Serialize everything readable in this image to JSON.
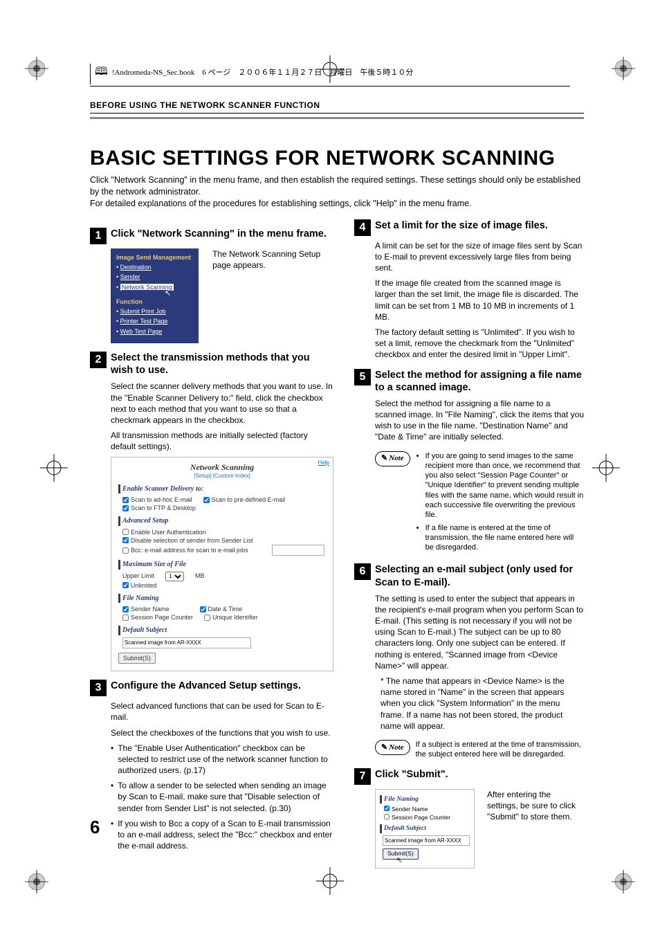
{
  "running_head": "!Andromeda-NS_Sec.book　6 ページ　２００６年１１月２７日　月曜日　午後５時１０分",
  "section_header": "BEFORE USING THE NETWORK SCANNER FUNCTION",
  "main_title": "BASIC SETTINGS FOR NETWORK SCANNING",
  "intro_p1": "Click \"Network Scanning\" in the menu frame, and then establish the required settings. These settings should only be established by the network administrator.",
  "intro_p2": "For detailed explanations of the procedures for establishing settings, click \"Help\" in the menu frame.",
  "step1": {
    "num": "1",
    "title": "Click \"Network Scanning\" in the menu frame.",
    "desc": "The Network Scanning Setup page appears.",
    "menu": {
      "hdr1": "Image Send Management",
      "i1": "Destination",
      "i2": "Sender",
      "i3": "Network Scanning",
      "hdr2": "Function",
      "i4": "Submit Print Job",
      "i5": "Printer Test Page",
      "i6": "Web Test Page"
    }
  },
  "step2": {
    "num": "2",
    "title": "Select the transmission methods that you wish to use.",
    "p1": "Select the scanner delivery methods that you want to use. In the \"Enable Scanner Delivery to:\" field, click the checkbox next to each method that you want to use so that a checkmark appears in the checkbox.",
    "p2": "All transmission methods are initially selected (factory default settings).",
    "form": {
      "help": "Help",
      "title": "Network Scanning",
      "sublinks": "[Setup] [Custom Index]",
      "sec_enable": "Enable Scanner Delivery to:",
      "cb_adhoc": "Scan to ad-hoc E-mail",
      "cb_predef": "Scan to pre-defined E-mail",
      "cb_ftp": "Scan to FTP & Desktop",
      "sec_adv": "Advanced Setup",
      "cb_auth": "Enable User Authentication",
      "cb_disable": "Disable selection of sender from Sender List",
      "lbl_bcc": "Bcc: e-mail address for scan to e-mail jobs",
      "sec_max": "Maximum Size of File",
      "lbl_upper": "Upper Limit",
      "sel_val": "1",
      "lbl_mb": "MB",
      "cb_unl": "Unlimited",
      "sec_file": "File Naming",
      "cb_sender": "Sender Name",
      "cb_date": "Date & Time",
      "cb_session": "Session Page Counter",
      "cb_unique": "Unique Identifier",
      "sec_def": "Default Subject",
      "txt_def": "Scanned image from AR-XXXX",
      "btn": "Submit(S)"
    }
  },
  "step3": {
    "num": "3",
    "title": "Configure the Advanced Setup settings.",
    "p1": "Select advanced functions that can be used for Scan to E-mail.",
    "p2": "Select the checkboxes of the functions that you wish to use.",
    "b1": "The \"Enable User Authentication\" checkbox can be selected to restrict use of the network scanner function to authorized users. (p.17)",
    "b2": "To allow a sender to be selected when sending an image by Scan to E-mail, make sure that \"Disable selection of sender from Sender List\" is not selected. (p.30)",
    "b3": "If you wish to Bcc a copy of a Scan to E-mail transmission to an e-mail address, select the \"Bcc:\" checkbox and enter the e-mail address."
  },
  "step4": {
    "num": "4",
    "title": "Set a limit for the size of image files.",
    "p1": "A limit can be set for the size of image files sent by Scan to E-mail to prevent excessively large files from being sent.",
    "p2": "If the image file created from the scanned image is larger than the set limit, the image file is discarded. The limit can be set from 1 MB to 10 MB in increments of 1 MB.",
    "p3": "The factory default setting is \"Unlimited\". If you wish to set a limit, remove the checkmark from the \"Unlimited\" checkbox and enter the desired limit in \"Upper Limit\"."
  },
  "step5": {
    "num": "5",
    "title": "Select the method for assigning a file name to a scanned image.",
    "p1": "Select the method for assigning a file name to a scanned image. In \"File Naming\", click the items that you wish to use in the file name. \"Destination Name\" and \"Date & Time\" are initially selected.",
    "note_label": "Note",
    "n1": "If you are going to send images to the same recipient more than once, we recommend that you also select \"Session Page Counter\" or \"Unique Identifier\" to prevent sending multiple files with the same name, which would result in each successive file overwriting the previous file.",
    "n2": "If a file name is entered at the time of transmission, the file name entered here will be disregarded."
  },
  "step6": {
    "num": "6",
    "title": "Selecting an e-mail subject (only used for Scan to E-mail).",
    "p1": "The setting is used to enter the subject that appears in the recipient's e-mail program when you perform Scan to E-mail. (This setting is not necessary if you will not be using Scan to E-mail.) The subject can be up to 80 characters long. Only one subject can be entered. If nothing is entered, \"Scanned image from <Device Name>\" will appear.",
    "p2": "* The name that appears in <Device Name> is the name stored in \"Name\" in the screen that appears when you click \"System Information\" in the menu frame. If a name has not been stored, the product name will appear.",
    "note_label": "Note",
    "n1": "If a subject is entered at the time of transmission, the subject entered here will be disregarded."
  },
  "step7": {
    "num": "7",
    "title": "Click \"Submit\".",
    "desc": "After entering the settings, be sure to click \"Submit\" to store them.",
    "stub": {
      "sec_file": "File Naming",
      "cb_sender": "Sender Name",
      "cb_session": "Session Page Counter",
      "sec_def": "Default Subject",
      "txt_def": "Scanned image from AR-XXXX",
      "btn": "Submit(S)"
    }
  },
  "page_number": "6"
}
